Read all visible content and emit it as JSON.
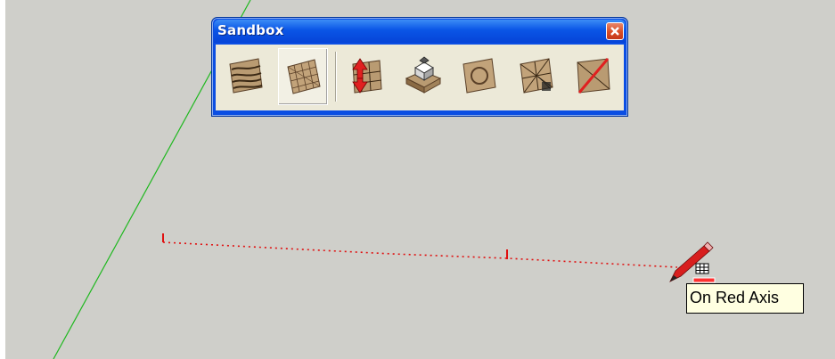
{
  "toolbar": {
    "title": "Sandbox",
    "tools": [
      {
        "name": "from-contours-icon"
      },
      {
        "name": "from-scratch-icon"
      },
      {
        "name": "smoove-icon"
      },
      {
        "name": "stamp-icon"
      },
      {
        "name": "drape-icon"
      },
      {
        "name": "add-detail-icon"
      },
      {
        "name": "flip-edge-icon"
      }
    ],
    "active_tool_index": 1
  },
  "tooltip": {
    "text": "On Red Axis"
  },
  "colors": {
    "viewport_bg": "#cfcfca",
    "green_axis": "#00c000",
    "red_axis": "#e00000",
    "titlebar_blue": "#0a55e6",
    "tooltip_bg": "#ffffe1"
  },
  "cursor": {
    "name": "pencil-icon",
    "inference": "grid-inference-icon"
  }
}
